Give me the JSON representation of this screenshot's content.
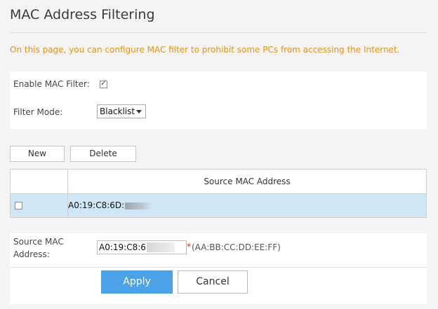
{
  "page": {
    "title": "MAC Address Filtering",
    "description": "On this page, you can configure MAC filter to prohibit some PCs from accessing the Internet."
  },
  "settings": {
    "enable_label": "Enable MAC Filter:",
    "enable_checked": true,
    "mode_label": "Filter Mode:",
    "mode_value": "Blacklist"
  },
  "toolbar": {
    "new_label": "New",
    "delete_label": "Delete"
  },
  "table": {
    "header": "Source MAC Address",
    "rows": [
      {
        "mac": "A0:19:C8:6D:",
        "checked": false
      }
    ]
  },
  "form": {
    "mac_label": "Source MAC Address:",
    "mac_value": "A0:19:C8:6D",
    "required_marker": "*",
    "format_hint": "(AA:BB:CC:DD:EE:FF)",
    "apply_label": "Apply",
    "cancel_label": "Cancel"
  },
  "colors": {
    "accent": "#4aa3e6",
    "description": "#e8920e",
    "selected_row": "#cfe6f7"
  }
}
